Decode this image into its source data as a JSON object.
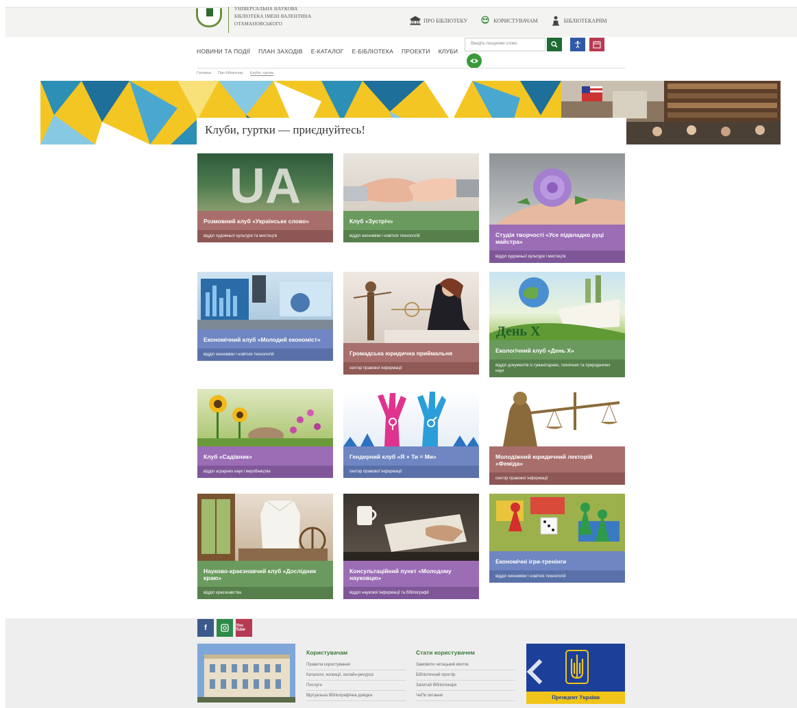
{
  "header": {
    "logo_lines": [
      "Універсальна наукова",
      "бібліотека імені Валентина",
      "Отамановського"
    ],
    "top_links": [
      {
        "label": "Про бібліотеку",
        "icon": "library-building-icon"
      },
      {
        "label": "Користувачам",
        "icon": "users-icon"
      },
      {
        "label": "Бібліотекарям",
        "icon": "librarian-icon"
      }
    ]
  },
  "nav": {
    "items": [
      "Новини та події",
      "План заходів",
      "Е-каталог",
      "Е-бібліотека",
      "Проекти",
      "Клуби"
    ],
    "search_placeholder": "Введіть пошукове слово"
  },
  "breadcrumb": [
    "Головна",
    "Про бібліотеку",
    "Клуби, гуртки"
  ],
  "page_title": "Клуби, гуртки — приєднуйтесь!",
  "cards": [
    {
      "title": "Розмовний клуб «Українське слово»",
      "subtitle": "відділ художньої культури та мистецтв"
    },
    {
      "title": "Клуб «Зустріч»",
      "subtitle": "відділ економіки і новітніх технологій"
    },
    {
      "title": "Студія творчості «Усе підвладно руці майстра»",
      "subtitle": "відділ художньої культури і мистецтв"
    },
    {
      "title": "Економічний клуб «Молодий економіст»",
      "subtitle": "відділ економіки і новітніх технологій"
    },
    {
      "title": "Громадська юридична приймальня",
      "subtitle": "сектор правової інформації"
    },
    {
      "title": "Екологічний клуб «День Х»",
      "subtitle": "відділ документів із гуманітарних, технічних та природничих наук"
    },
    {
      "title": "Клуб «Садівник»",
      "subtitle": "відділ аграрних наук і виробництва"
    },
    {
      "title": "Гендерний клуб «Я + Ти = Ми»",
      "subtitle": "сектор правової інформації"
    },
    {
      "title": "Молодіжний юридичний лекторій «Феміда»",
      "subtitle": "сектор правової інформації"
    },
    {
      "title": "Науково-краєзнавчий клуб «Дослідник краю»",
      "subtitle": "відділ краєзнавства"
    },
    {
      "title": "Консультаційний пункт «Молодому науковцю»",
      "subtitle": "відділ наукової інформації та бібліографії"
    },
    {
      "title": "Економічні ігри-тренінги",
      "subtitle": "відділ економіки і новітніх технологій"
    }
  ],
  "card_image_texts": {
    "ua": "UA",
    "den_x": "День Х"
  },
  "footer": {
    "social": [
      "f",
      "ig",
      "You Tube"
    ],
    "col1": {
      "title": "Користувачам",
      "links": [
        "Правила користування",
        "Каталоги, колекції, онлайн-ресурси",
        "Послуги",
        "Віртуальна бібліографічна довідка"
      ]
    },
    "col2": {
      "title": "Стати користувачем",
      "links": [
        "Замовити читацький квиток",
        "Бібліотечний простір",
        "Запитай бібліотекаря",
        "ЧаПи питання"
      ]
    },
    "president_label": "Президент України"
  },
  "colors": {
    "primary_green": "#1e6b33",
    "accent_green": "#6a8f3e",
    "banner_yellow": "#f3c623",
    "banner_blue": "#2c8fb5"
  }
}
